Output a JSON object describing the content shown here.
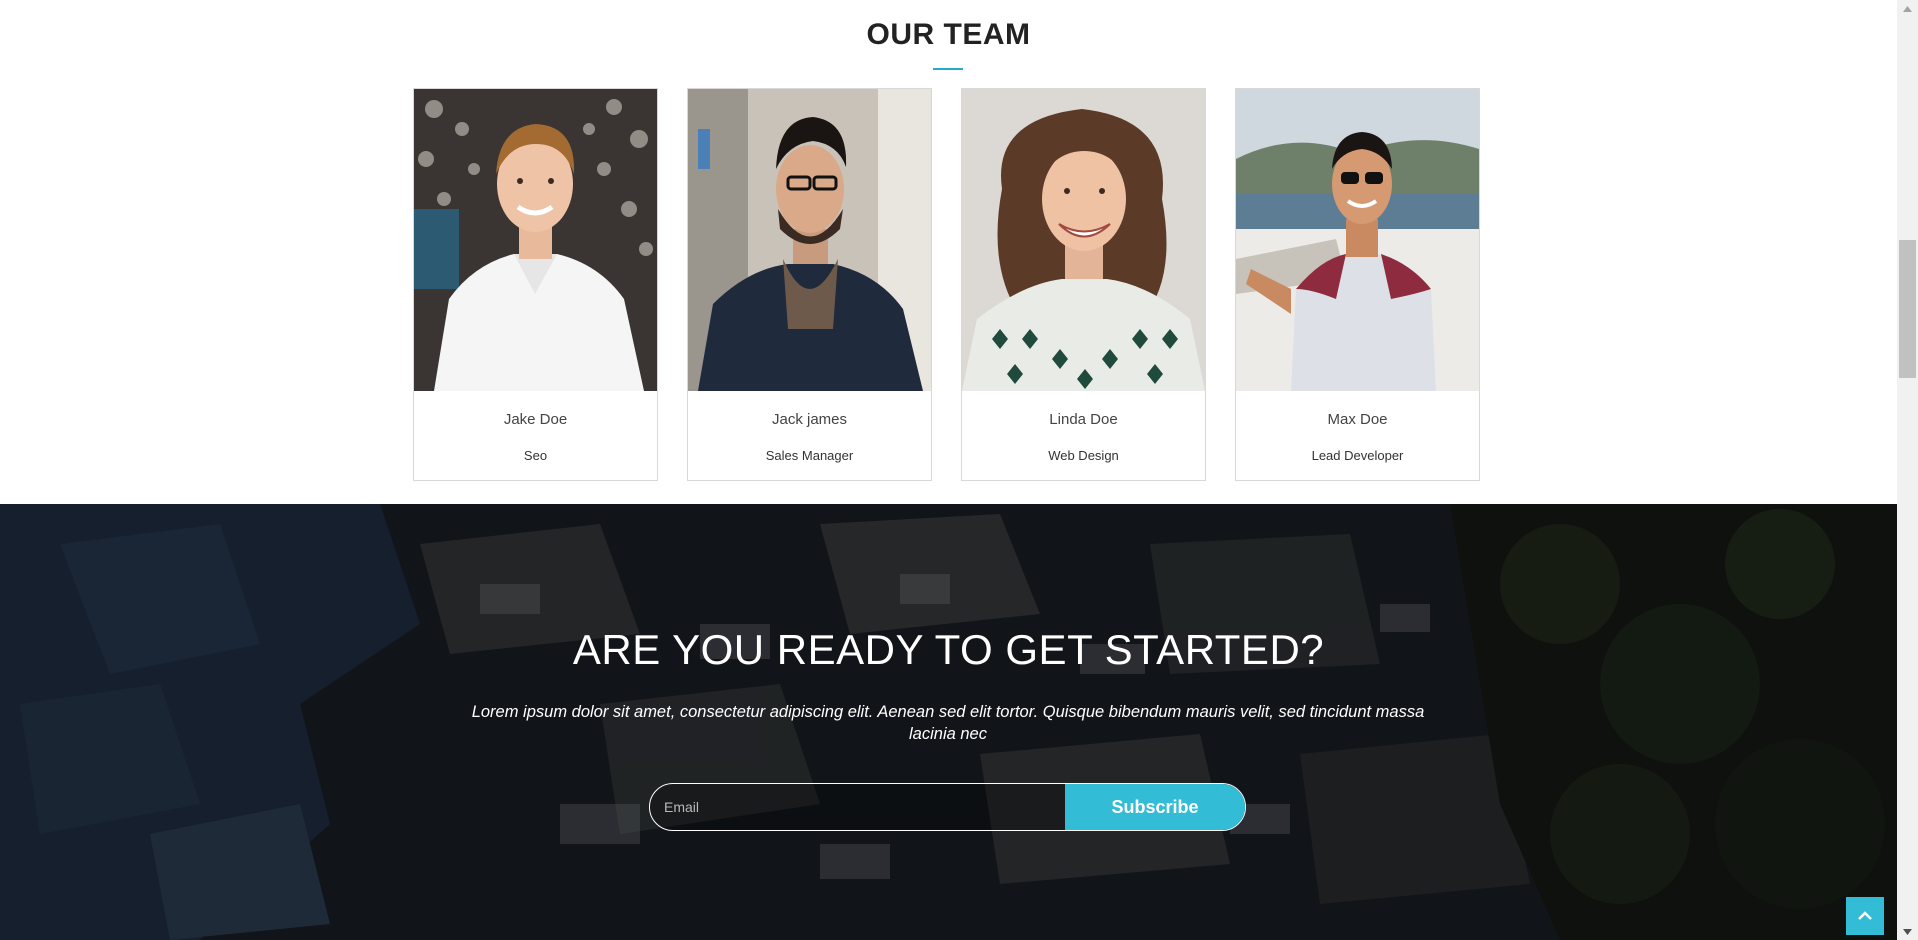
{
  "team": {
    "title": "OUR TEAM",
    "members": [
      {
        "name": "Jake Doe",
        "role": "Seo"
      },
      {
        "name": "Jack james",
        "role": "Sales Manager"
      },
      {
        "name": "Linda Doe",
        "role": "Web Design"
      },
      {
        "name": "Max Doe",
        "role": "Lead Developer"
      }
    ]
  },
  "cta": {
    "title": "ARE YOU READY TO GET STARTED?",
    "text": "Lorem ipsum dolor sit amet, consectetur adipiscing elit. Aenean sed elit tortor. Quisque bibendum mauris velit, sed tincidunt massa lacinia nec",
    "email_placeholder": "Email",
    "subscribe_label": "Subscribe"
  },
  "colors": {
    "accent": "#33bcd6",
    "heading": "#222222",
    "card_border": "#d8d8d8"
  },
  "icons": {
    "back_to_top": "chevron-up-icon"
  }
}
